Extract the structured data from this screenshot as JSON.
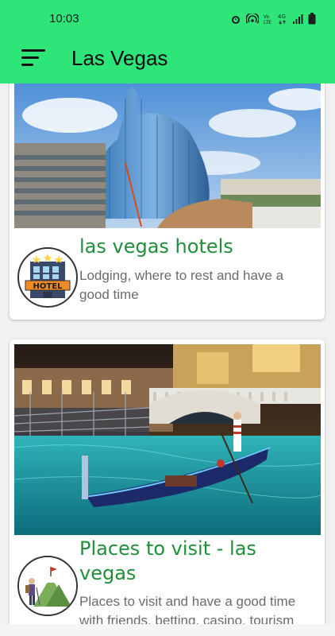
{
  "status_bar": {
    "time": "10:03",
    "icons": [
      "alarm-icon",
      "hotspot-icon",
      "volte-icon",
      "4g-icon",
      "signal-icon",
      "battery-icon"
    ]
  },
  "app_bar": {
    "title": "Las Vegas",
    "menu_icon": "menu-icon",
    "background": "#2ee57a"
  },
  "cards": [
    {
      "title": "las vegas hotels",
      "description": "Lodging, where to rest and have a good time",
      "image": "guitar-hotel-photo",
      "icon": "hotel-icon"
    },
    {
      "title": "Places to visit - las vegas",
      "description": "Places to visit and have a good time with friends, betting, casino, tourism",
      "image": "venetian-gondola-photo",
      "icon": "hiker-mountain-icon"
    }
  ],
  "colors": {
    "title_green": "#1f8f3a",
    "desc_gray": "#6b6b6b"
  }
}
